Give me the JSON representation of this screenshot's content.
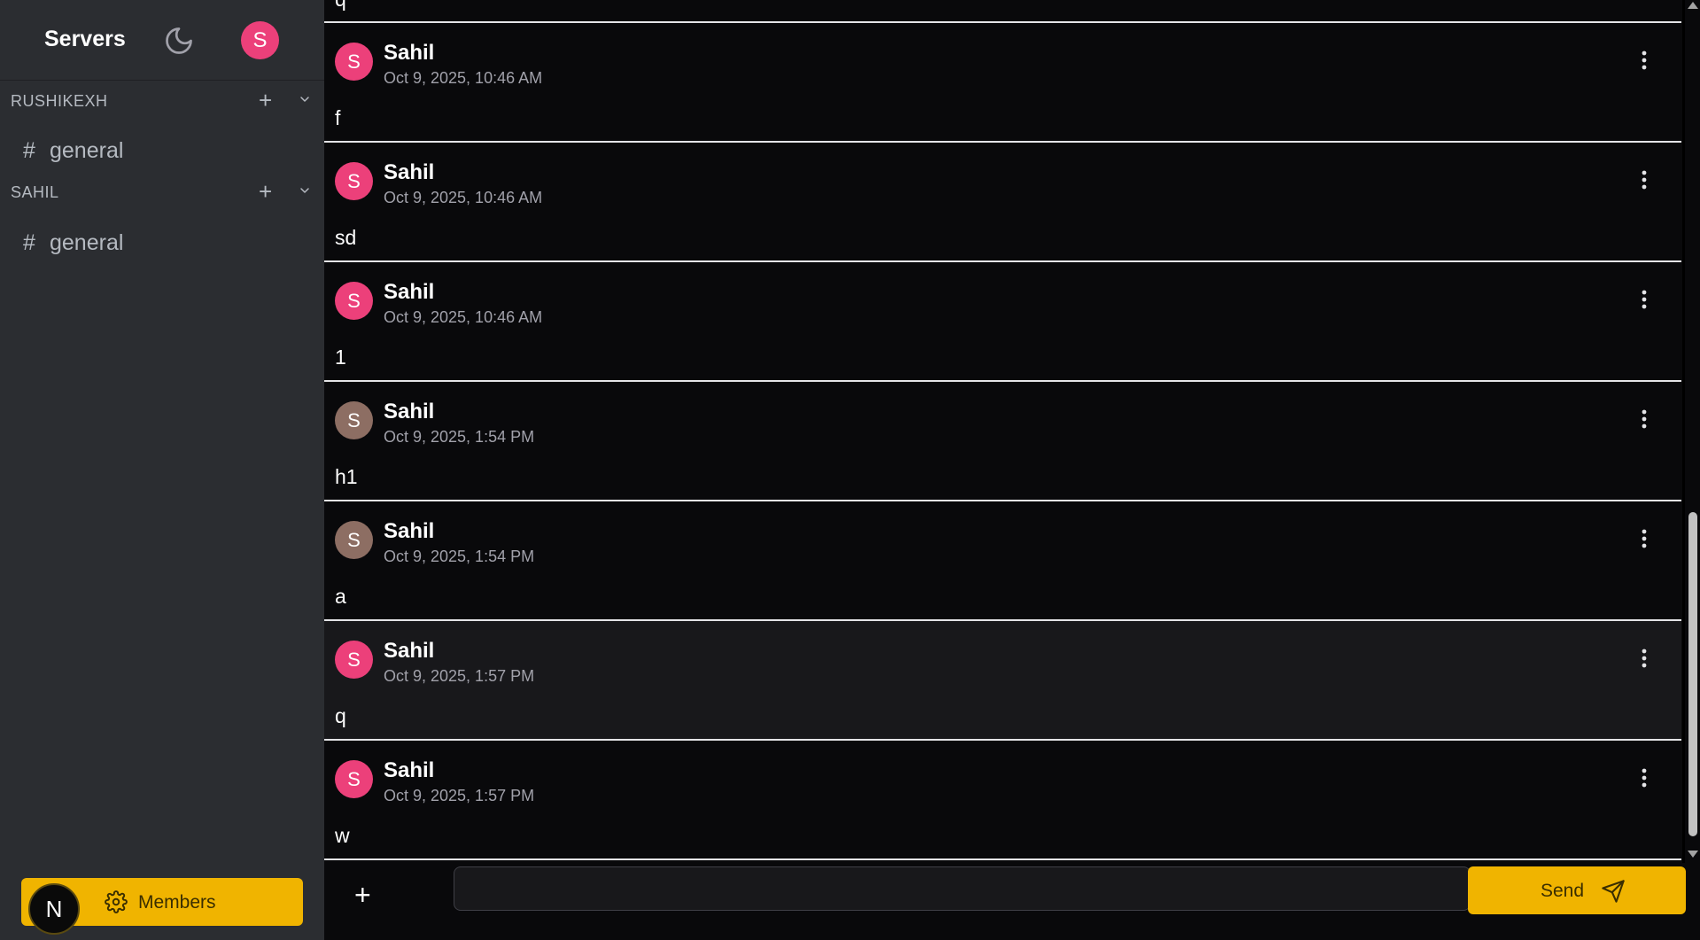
{
  "sidebar": {
    "title": "Servers",
    "user_initial": "S",
    "servers": [
      {
        "name": "RUSHIKEXH",
        "channels": [
          {
            "label": "general"
          }
        ]
      },
      {
        "name": "SAHIL",
        "channels": [
          {
            "label": "general"
          }
        ]
      }
    ],
    "members_label": "Members",
    "badge_letter": "N"
  },
  "messages": {
    "top_fragment": "q",
    "items": [
      {
        "author": "Sahil",
        "initial": "S",
        "time": "Oct 9, 2025, 10:46 AM",
        "body": "f",
        "avatar_color": "#ec407a"
      },
      {
        "author": "Sahil",
        "initial": "S",
        "time": "Oct 9, 2025, 10:46 AM",
        "body": "sd",
        "avatar_color": "#ec407a"
      },
      {
        "author": "Sahil",
        "initial": "S",
        "time": "Oct 9, 2025, 10:46 AM",
        "body": "1",
        "avatar_color": "#ec407a"
      },
      {
        "author": "Sahil",
        "initial": "S",
        "time": "Oct 9, 2025, 1:54 PM",
        "body": "h1",
        "avatar_color": "#8d6e63"
      },
      {
        "author": "Sahil",
        "initial": "S",
        "time": "Oct 9, 2025, 1:54 PM",
        "body": "a",
        "avatar_color": "#8d6e63"
      },
      {
        "author": "Sahil",
        "initial": "S",
        "time": "Oct 9, 2025, 1:57 PM",
        "body": "q",
        "avatar_color": "#ec407a"
      },
      {
        "author": "Sahil",
        "initial": "S",
        "time": "Oct 9, 2025, 1:57 PM",
        "body": "w",
        "avatar_color": "#ec407a"
      }
    ]
  },
  "composer": {
    "input_value": "",
    "input_placeholder": "",
    "send_label": "Send"
  },
  "colors": {
    "accent": "#f0b400",
    "sidebar_bg": "#2b2d31",
    "chat_bg": "#09090b"
  }
}
